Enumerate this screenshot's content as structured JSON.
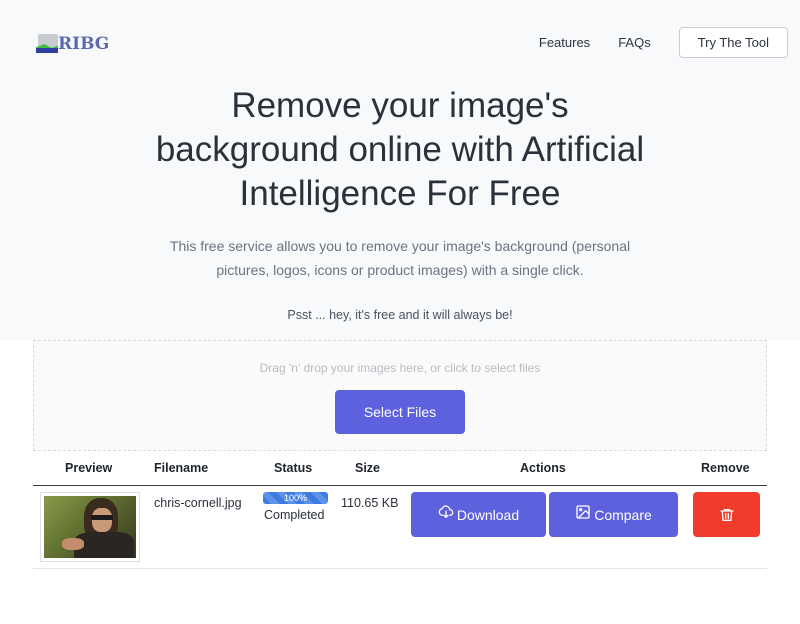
{
  "header": {
    "logo_text": "RIBG",
    "nav": {
      "features": "Features",
      "faqs": "FAQs",
      "try_button": "Try The Tool"
    }
  },
  "hero": {
    "title_line1": "Remove your image's",
    "title_line2": "background online with Artificial",
    "title_line3": "Intelligence For Free",
    "desc_line1": "This free service allows you to remove your image's background (personal",
    "desc_line2": "pictures, logos, icons or product images) with a single click.",
    "psst": "Psst ... hey, it's free and it will always be!"
  },
  "upload": {
    "drop_text": "Drag 'n' drop your images here, or click to select files",
    "select_button": "Select Files"
  },
  "table": {
    "headers": {
      "preview": "Preview",
      "filename": "Filename",
      "status": "Status",
      "size": "Size",
      "actions": "Actions",
      "remove": "Remove"
    },
    "rows": [
      {
        "filename": "chris-cornell.jpg",
        "progress_label": "100%",
        "progress": 1.0,
        "status": "Completed",
        "size": "110.65 KB",
        "download_label": "Download",
        "compare_label": "Compare",
        "icons": {
          "download": "cloud-download-icon",
          "compare": "image-icon",
          "remove": "trash-icon"
        }
      }
    ]
  },
  "colors": {
    "primary": "#5d61dd",
    "danger": "#f23c2b",
    "progress": "#3d7be0",
    "hero_bg": "#f8f9fb"
  }
}
